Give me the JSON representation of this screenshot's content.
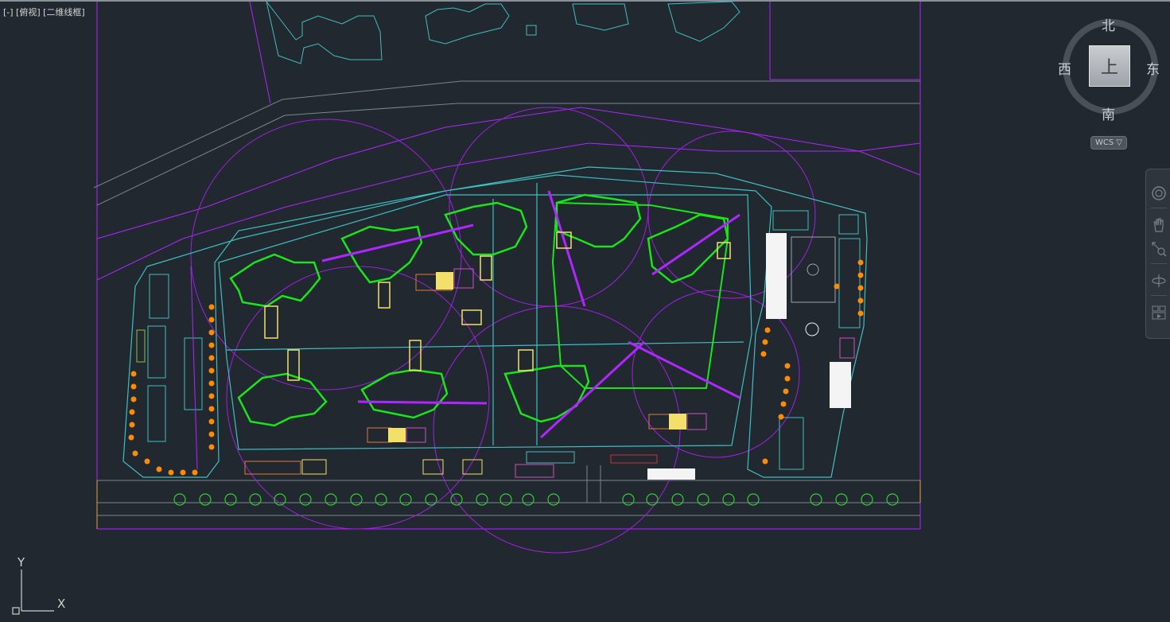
{
  "view": {
    "controls_label": "[-] [俯视] [二维线框]"
  },
  "viewcube": {
    "face_label": "上",
    "north": "北",
    "south": "南",
    "west": "西",
    "east": "东"
  },
  "wcs": {
    "label": "WCS",
    "arrow": "▽"
  },
  "ucs": {
    "x_label": "X",
    "y_label": "Y"
  },
  "navbar": {
    "tools": [
      "steering-wheel-icon",
      "pan-icon",
      "zoom-extents-icon",
      "orbit-icon",
      "showmotion-icon"
    ]
  },
  "colors": {
    "background": "#212830",
    "building_green": "#19e619",
    "boundary_magenta": "#b026ff",
    "road_cyan": "#3fbfbf",
    "tree_orange": "#ff8c00",
    "highlight_yellow": "#f2e06a",
    "tree_row_green": "#33cc33"
  }
}
